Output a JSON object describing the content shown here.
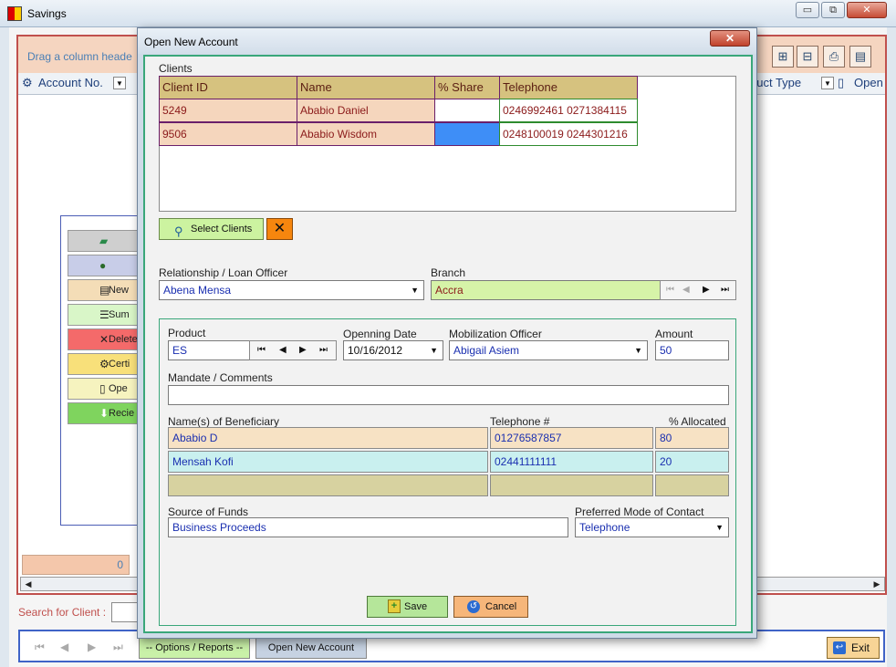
{
  "main_window": {
    "title": "Savings",
    "controls": {
      "minimize": "▭",
      "restore": "⧉",
      "close": "✕"
    },
    "group_hint": "Drag a column heade",
    "columns": [
      {
        "label": "Account No."
      },
      {
        "label": "duct Type"
      },
      {
        "label": "Open"
      }
    ],
    "side_buttons": [
      {
        "label": "",
        "icon": "folder-open-icon",
        "color": "#cfcfcf"
      },
      {
        "label": "",
        "icon": "user-icon",
        "color": "#c8cde8"
      },
      {
        "label": "New",
        "icon": "document-icon",
        "color": "#f4ddb7"
      },
      {
        "label": "Sum",
        "icon": "list-icon",
        "color": "#d9f6c8"
      },
      {
        "label": "Delete",
        "icon": "x-icon",
        "color": "#f46a6a"
      },
      {
        "label": "Certi",
        "icon": "gear-icon",
        "color": "#f8e07a"
      },
      {
        "label": "Ope",
        "icon": "page-icon",
        "color": "#f6f3bf"
      },
      {
        "label": "Recie",
        "icon": "download-icon",
        "color": "#7fd45e"
      }
    ],
    "count": "0",
    "search_label": "Search for Client :",
    "bottom_tabs": [
      {
        "label": "-- Options / Reports --"
      },
      {
        "label": "Open New Account"
      }
    ],
    "exit_label": "Exit"
  },
  "dialog": {
    "title": "Open New Account",
    "close_glyph": "✕",
    "clients": {
      "label": "Clients",
      "headers": [
        "Client ID",
        "Name",
        "% Share",
        "Telephone"
      ],
      "rows": [
        {
          "id": "5249",
          "name": "Ababio Daniel",
          "share": "",
          "telephone": "0246992461 0271384115"
        },
        {
          "id": "9506",
          "name": "Ababio Wisdom",
          "share": "",
          "telephone": "0248100019 0244301216"
        }
      ]
    },
    "select_clients_label": "Select Clients",
    "relationship_officer": {
      "label": "Relationship / Loan Officer",
      "value": "Abena Mensa"
    },
    "branch": {
      "label": "Branch",
      "value": "Accra"
    },
    "product": {
      "label": "Product",
      "value": "ES"
    },
    "opening_date": {
      "label": "Openning Date",
      "value": "10/16/2012"
    },
    "mobilization_officer": {
      "label": "Mobilization Officer",
      "value": "Abigail Asiem"
    },
    "amount": {
      "label": "Amount",
      "value": "50"
    },
    "mandate": {
      "label": "Mandate / Comments",
      "value": ""
    },
    "beneficiaries": {
      "headers": {
        "name": "Name(s) of Beneficiary",
        "telephone": "Telephone #",
        "allocated": "% Allocated"
      },
      "rows": [
        {
          "name": "Ababio D",
          "telephone": "01276587857",
          "allocated": "80"
        },
        {
          "name": "Mensah Kofi",
          "telephone": "02441111111",
          "allocated": "20"
        },
        {
          "name": "",
          "telephone": "",
          "allocated": ""
        }
      ]
    },
    "source_of_funds": {
      "label": "Source of Funds",
      "value": "Business Proceeds"
    },
    "preferred_contact": {
      "label": "Preferred Mode of Contact",
      "value": "Telephone"
    },
    "save_label": "Save",
    "cancel_label": "Cancel"
  },
  "colors": {
    "frame_red": "#c0504d",
    "dialog_border_green": "#3aa77a",
    "grid_header": "#d6c27f",
    "grid_row": "#f5d6bd",
    "share_selected": "#3e8ef7",
    "field_text": "#1a2fb0"
  }
}
